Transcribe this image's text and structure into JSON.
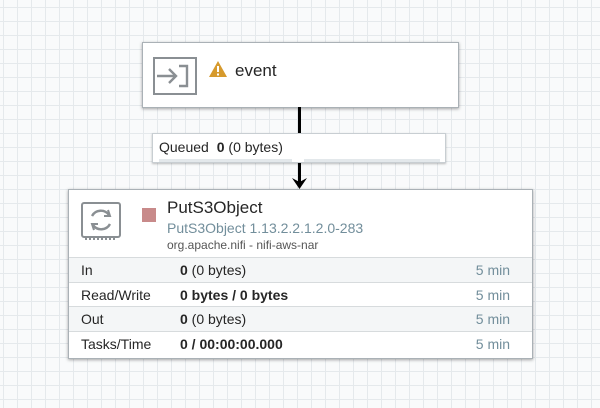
{
  "input_port": {
    "name": "event",
    "icon": "input-port-icon",
    "warning_icon": "warning-triangle-icon",
    "warning_color": "#d69a2d"
  },
  "connection": {
    "label": "Queued",
    "count": "0",
    "size": "(0 bytes)"
  },
  "processor": {
    "name": "PutS3Object",
    "type": "PutS3Object 1.13.2.2.1.2.0-283",
    "bundle": "org.apache.nifi - nifi-aws-nar",
    "icon": "processor-icon",
    "status_icon": "stopped-icon",
    "status_color": "#c88a8a",
    "stats": [
      {
        "label": "In",
        "value": "0",
        "value_suffix": " (0 bytes)",
        "time": "5 min"
      },
      {
        "label": "Read/Write",
        "value": "0 bytes / 0 bytes",
        "value_suffix": "",
        "time": "5 min"
      },
      {
        "label": "Out",
        "value": "0",
        "value_suffix": " (0 bytes)",
        "time": "5 min"
      },
      {
        "label": "Tasks/Time",
        "value": "0 / 00:00:00.000",
        "value_suffix": "",
        "time": "5 min"
      }
    ]
  }
}
